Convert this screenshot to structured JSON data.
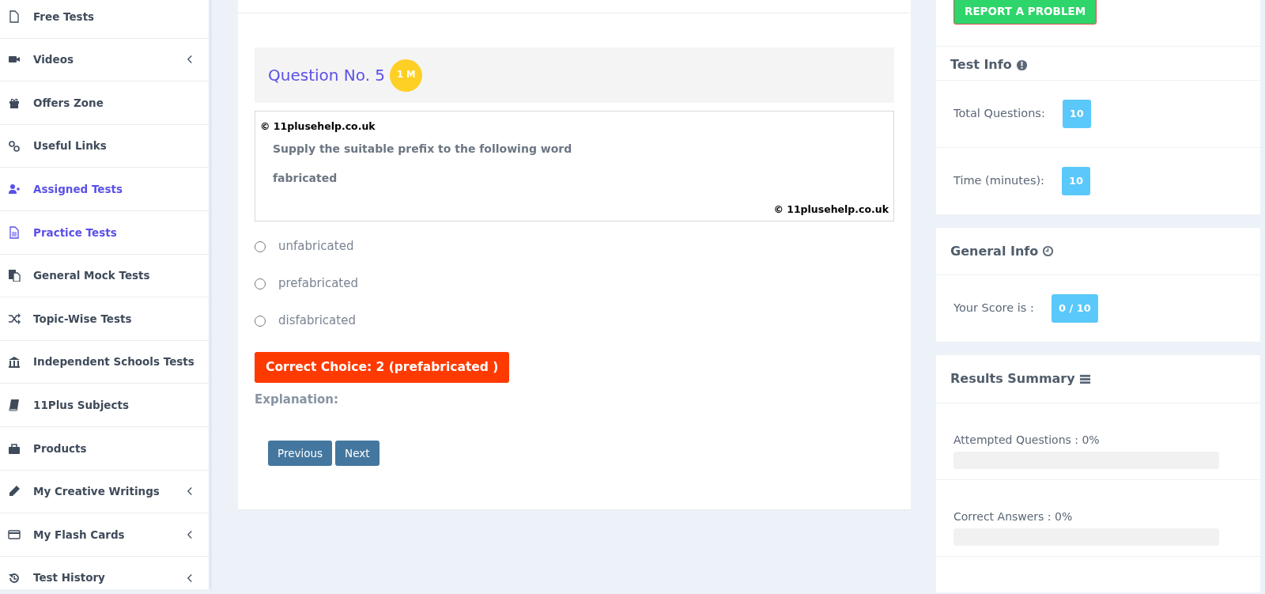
{
  "sidebar": {
    "items": [
      {
        "label": "Free Tests",
        "selected": false,
        "has_submenu": false
      },
      {
        "label": "Videos",
        "selected": false,
        "has_submenu": true
      },
      {
        "label": "Offers Zone",
        "selected": false,
        "has_submenu": false
      },
      {
        "label": "Useful Links",
        "selected": false,
        "has_submenu": false
      },
      {
        "label": "Assigned Tests",
        "selected": true,
        "has_submenu": false
      },
      {
        "label": "Practice Tests",
        "selected": true,
        "has_submenu": false
      },
      {
        "label": "General Mock Tests",
        "selected": false,
        "has_submenu": false
      },
      {
        "label": "Topic-Wise Tests",
        "selected": false,
        "has_submenu": false
      },
      {
        "label": "Independent Schools Tests",
        "selected": false,
        "has_submenu": false
      },
      {
        "label": "11Plus Subjects",
        "selected": false,
        "has_submenu": false
      },
      {
        "label": "Products",
        "selected": false,
        "has_submenu": false
      },
      {
        "label": "My Creative Writings",
        "selected": false,
        "has_submenu": true
      },
      {
        "label": "My Flash Cards",
        "selected": false,
        "has_submenu": true
      },
      {
        "label": "Test History",
        "selected": false,
        "has_submenu": true
      }
    ]
  },
  "question": {
    "title": "Question No. 5",
    "marks": "1 M",
    "copyright_top": "© 11plusehelp.co.uk",
    "prompt": "Supply the suitable prefix to the following word",
    "word": "fabricated",
    "copyright_bottom": "© 11plusehelp.co.uk",
    "options": [
      {
        "label": "unfabricated",
        "selected": false
      },
      {
        "label": "prefabricated",
        "selected": false
      },
      {
        "label": "disfabricated",
        "selected": false
      }
    ],
    "correct_choice": "Correct Choice: 2 (prefabricated )",
    "explanation_label": "Explanation:",
    "buttons": [
      "Previous",
      "Next"
    ]
  },
  "report_button": "REPORT A PROBLEM",
  "test_info": {
    "title": "Test Info",
    "rows": [
      {
        "label": "Total Questions:",
        "value": "10"
      },
      {
        "label": "Time (minutes):",
        "value": "10"
      }
    ]
  },
  "general_info": {
    "title": "General Info",
    "rows": [
      {
        "label": "Your Score is :",
        "value": "0 / 10"
      }
    ]
  },
  "results_summary": {
    "title": "Results Summary",
    "bars": [
      {
        "label": "Attempted Questions : 0%",
        "level": 0
      },
      {
        "label": "Correct Answers : 0%",
        "level": 0
      }
    ]
  }
}
